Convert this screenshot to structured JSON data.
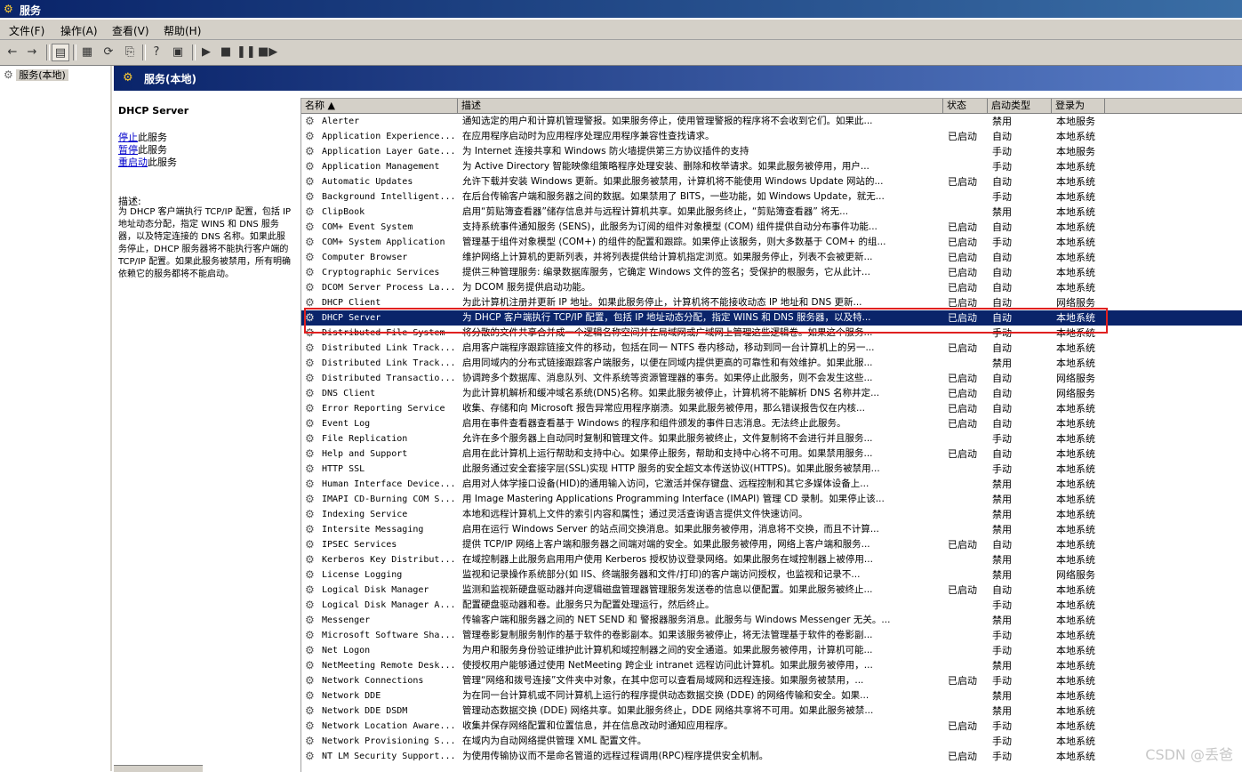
{
  "window": {
    "title": "服务"
  },
  "menu": [
    "文件(F)",
    "操作(A)",
    "查看(V)",
    "帮助(H)"
  ],
  "tree": {
    "item": "服务(本地)"
  },
  "main_header": {
    "title": "服务(本地)"
  },
  "desc_pane": {
    "service_name": "DHCP Server",
    "actions": [
      {
        "link": "停止",
        "rest": "此服务"
      },
      {
        "link": "暂停",
        "rest": "此服务"
      },
      {
        "link": "重启动",
        "rest": "此服务"
      }
    ],
    "desc_label": "描述:",
    "desc_text": "为 DHCP 客户端执行 TCP/IP 配置，包括 IP 地址动态分配，指定 WINS 和 DNS 服务器，以及特定连接的 DNS 名称。如果此服务停止，DHCP 服务器将不能执行客户端的 TCP/IP 配置。如果此服务被禁用，所有明确依赖它的服务都将不能启动。"
  },
  "columns": {
    "name": "名称 ▲",
    "desc": "描述",
    "status": "状态",
    "startup": "启动类型",
    "logon": "登录为"
  },
  "services": [
    {
      "name": "Alerter",
      "desc": "通知选定的用户和计算机管理警报。如果服务停止，使用管理警报的程序将不会收到它们。如果此...",
      "status": "",
      "startup": "禁用",
      "logon": "本地服务"
    },
    {
      "name": "Application Experience...",
      "desc": "在应用程序启动时为应用程序处理应用程序兼容性查找请求。",
      "status": "已启动",
      "startup": "自动",
      "logon": "本地系统"
    },
    {
      "name": "Application Layer Gate...",
      "desc": "为 Internet 连接共享和 Windows 防火墙提供第三方协议插件的支持",
      "status": "",
      "startup": "手动",
      "logon": "本地服务"
    },
    {
      "name": "Application Management",
      "desc": "为 Active Directory 智能映像组策略程序处理安装、删除和枚举请求。如果此服务被停用，用户...",
      "status": "",
      "startup": "手动",
      "logon": "本地系统"
    },
    {
      "name": "Automatic Updates",
      "desc": "允许下载并安装 Windows 更新。如果此服务被禁用，计算机将不能使用 Windows Update 网站的...",
      "status": "已启动",
      "startup": "自动",
      "logon": "本地系统"
    },
    {
      "name": "Background Intelligent...",
      "desc": "在后台传输客户端和服务器之间的数据。如果禁用了 BITS，一些功能，如 Windows Update，就无...",
      "status": "",
      "startup": "手动",
      "logon": "本地系统"
    },
    {
      "name": "ClipBook",
      "desc": "启用“剪贴簿查看器”储存信息并与远程计算机共享。如果此服务终止，“剪贴簿查看器” 将无...",
      "status": "",
      "startup": "禁用",
      "logon": "本地系统"
    },
    {
      "name": "COM+ Event System",
      "desc": "支持系统事件通知服务 (SENS)，此服务为订阅的组件对象模型 (COM) 组件提供自动分布事件功能...",
      "status": "已启动",
      "startup": "自动",
      "logon": "本地系统"
    },
    {
      "name": "COM+ System Application",
      "desc": "管理基于组件对象模型 (COM+) 的组件的配置和跟踪。如果停止该服务，则大多数基于 COM+ 的组...",
      "status": "已启动",
      "startup": "手动",
      "logon": "本地系统"
    },
    {
      "name": "Computer Browser",
      "desc": "维护网络上计算机的更新列表，并将列表提供给计算机指定浏览。如果服务停止，列表不会被更新...",
      "status": "已启动",
      "startup": "自动",
      "logon": "本地系统"
    },
    {
      "name": "Cryptographic Services",
      "desc": "提供三种管理服务: 编录数据库服务，它确定 Windows 文件的签名；受保护的根服务，它从此计...",
      "status": "已启动",
      "startup": "自动",
      "logon": "本地系统"
    },
    {
      "name": "DCOM Server Process La...",
      "desc": "为 DCOM 服务提供启动功能。",
      "status": "已启动",
      "startup": "自动",
      "logon": "本地系统"
    },
    {
      "name": "DHCP Client",
      "desc": "为此计算机注册并更新 IP 地址。如果此服务停止，计算机将不能接收动态 IP 地址和 DNS 更新...",
      "status": "已启动",
      "startup": "自动",
      "logon": "网络服务"
    },
    {
      "name": "DHCP Server",
      "desc": "为 DHCP 客户端执行 TCP/IP 配置，包括 IP 地址动态分配，指定 WINS 和 DNS 服务器，以及特...",
      "status": "已启动",
      "startup": "自动",
      "logon": "本地系统"
    },
    {
      "name": "Distributed File System",
      "desc": "将分散的文件共享合并成一个逻辑名称空间并在局域网或广域网上管理这些逻辑卷。如果这个服务...",
      "status": "",
      "startup": "手动",
      "logon": "本地系统"
    },
    {
      "name": "Distributed Link Track...",
      "desc": "启用客户端程序跟踪链接文件的移动，包括在同一 NTFS 卷内移动，移动到同一台计算机上的另一...",
      "status": "已启动",
      "startup": "自动",
      "logon": "本地系统"
    },
    {
      "name": "Distributed Link Track...",
      "desc": "启用同域内的分布式链接跟踪客户端服务，以便在同域内提供更高的可靠性和有效维护。如果此服...",
      "status": "",
      "startup": "禁用",
      "logon": "本地系统"
    },
    {
      "name": "Distributed Transactio...",
      "desc": "协调跨多个数据库、消息队列、文件系统等资源管理器的事务。如果停止此服务，则不会发生这些...",
      "status": "已启动",
      "startup": "自动",
      "logon": "网络服务"
    },
    {
      "name": "DNS Client",
      "desc": "为此计算机解析和缓冲域名系统(DNS)名称。如果此服务被停止，计算机将不能解析 DNS 名称并定...",
      "status": "已启动",
      "startup": "自动",
      "logon": "网络服务"
    },
    {
      "name": "Error Reporting Service",
      "desc": "收集、存储和向 Microsoft 报告异常应用程序崩溃。如果此服务被停用，那么错误报告仅在内核...",
      "status": "已启动",
      "startup": "自动",
      "logon": "本地系统"
    },
    {
      "name": "Event Log",
      "desc": "启用在事件查看器查看基于 Windows 的程序和组件颁发的事件日志消息。无法终止此服务。",
      "status": "已启动",
      "startup": "自动",
      "logon": "本地系统"
    },
    {
      "name": "File Replication",
      "desc": "允许在多个服务器上自动同时复制和管理文件。如果此服务被终止，文件复制将不会进行并且服务...",
      "status": "",
      "startup": "手动",
      "logon": "本地系统"
    },
    {
      "name": "Help and Support",
      "desc": "启用在此计算机上运行帮助和支持中心。如果停止服务，帮助和支持中心将不可用。如果禁用服务...",
      "status": "已启动",
      "startup": "自动",
      "logon": "本地系统"
    },
    {
      "name": "HTTP SSL",
      "desc": "此服务通过安全套接字层(SSL)实现 HTTP 服务的安全超文本传送协议(HTTPS)。如果此服务被禁用...",
      "status": "",
      "startup": "手动",
      "logon": "本地系统"
    },
    {
      "name": "Human Interface Device...",
      "desc": "启用对人体学接口设备(HID)的通用输入访问，它激活并保存键盘、远程控制和其它多媒体设备上...",
      "status": "",
      "startup": "禁用",
      "logon": "本地系统"
    },
    {
      "name": "IMAPI CD-Burning COM S...",
      "desc": "用 Image Mastering Applications Programming Interface (IMAPI) 管理 CD 录制。如果停止该...",
      "status": "",
      "startup": "禁用",
      "logon": "本地系统"
    },
    {
      "name": "Indexing Service",
      "desc": "本地和远程计算机上文件的索引内容和属性；通过灵活查询语言提供文件快速访问。",
      "status": "",
      "startup": "禁用",
      "logon": "本地系统"
    },
    {
      "name": "Intersite Messaging",
      "desc": "启用在运行 Windows Server 的站点间交换消息。如果此服务被停用，消息将不交换，而且不计算...",
      "status": "",
      "startup": "禁用",
      "logon": "本地系统"
    },
    {
      "name": "IPSEC Services",
      "desc": "提供 TCP/IP 网络上客户端和服务器之间端对端的安全。如果此服务被停用，网络上客户端和服务...",
      "status": "已启动",
      "startup": "自动",
      "logon": "本地系统"
    },
    {
      "name": "Kerberos Key Distribut...",
      "desc": "在域控制器上此服务启用用户使用 Kerberos 授权协议登录网络。如果此服务在域控制器上被停用...",
      "status": "",
      "startup": "禁用",
      "logon": "本地系统"
    },
    {
      "name": "License Logging",
      "desc": "监视和记录操作系统部分(如 IIS、终端服务器和文件/打印)的客户端访问授权，也监视和记录不...",
      "status": "",
      "startup": "禁用",
      "logon": "网络服务"
    },
    {
      "name": "Logical Disk Manager",
      "desc": "监测和监视新硬盘驱动器并向逻辑磁盘管理器管理服务发送卷的信息以便配置。如果此服务被终止...",
      "status": "已启动",
      "startup": "自动",
      "logon": "本地系统"
    },
    {
      "name": "Logical Disk Manager A...",
      "desc": "配置硬盘驱动器和卷。此服务只为配置处理运行，然后终止。",
      "status": "",
      "startup": "手动",
      "logon": "本地系统"
    },
    {
      "name": "Messenger",
      "desc": "传输客户端和服务器之间的 NET SEND 和 警报器服务消息。此服务与 Windows Messenger 无关。...",
      "status": "",
      "startup": "禁用",
      "logon": "本地系统"
    },
    {
      "name": "Microsoft Software Sha...",
      "desc": "管理卷影复制服务制作的基于软件的卷影副本。如果该服务被停止，将无法管理基于软件的卷影副...",
      "status": "",
      "startup": "手动",
      "logon": "本地系统"
    },
    {
      "name": "Net Logon",
      "desc": "为用户和服务身份验证维护此计算机和域控制器之间的安全通道。如果此服务被停用，计算机可能...",
      "status": "",
      "startup": "手动",
      "logon": "本地系统"
    },
    {
      "name": "NetMeeting Remote Desk...",
      "desc": "使授权用户能够通过使用 NetMeeting 跨企业 intranet 远程访问此计算机。如果此服务被停用，...",
      "status": "",
      "startup": "禁用",
      "logon": "本地系统"
    },
    {
      "name": "Network Connections",
      "desc": "管理“网络和拨号连接”文件夹中对象，在其中您可以查看局域网和远程连接。如果服务被禁用，...",
      "status": "已启动",
      "startup": "手动",
      "logon": "本地系统"
    },
    {
      "name": "Network DDE",
      "desc": "为在同一台计算机或不同计算机上运行的程序提供动态数据交换 (DDE) 的网络传输和安全。如果...",
      "status": "",
      "startup": "禁用",
      "logon": "本地系统"
    },
    {
      "name": "Network DDE DSDM",
      "desc": "管理动态数据交换 (DDE) 网络共享。如果此服务终止，DDE 网络共享将不可用。如果此服务被禁...",
      "status": "",
      "startup": "禁用",
      "logon": "本地系统"
    },
    {
      "name": "Network Location Aware...",
      "desc": "收集并保存网络配置和位置信息，并在信息改动时通知应用程序。",
      "status": "已启动",
      "startup": "手动",
      "logon": "本地系统"
    },
    {
      "name": "Network Provisioning S...",
      "desc": "在域内为自动网络提供管理 XML 配置文件。",
      "status": "",
      "startup": "手动",
      "logon": "本地系统"
    },
    {
      "name": "NT LM Security Support...",
      "desc": "为使用传输协议而不是命名管道的远程过程调用(RPC)程序提供安全机制。",
      "status": "已启动",
      "startup": "手动",
      "logon": "本地系统"
    }
  ],
  "watermark": "CSDN @丢爸"
}
